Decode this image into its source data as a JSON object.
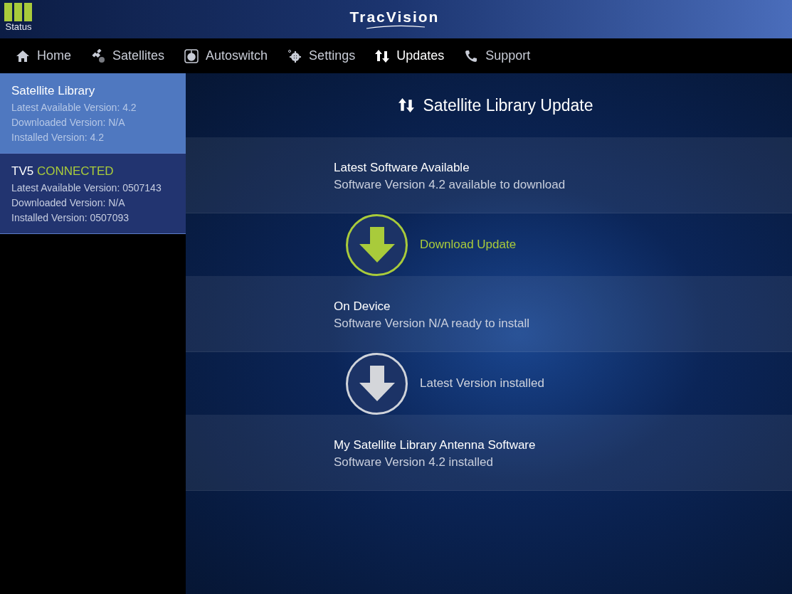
{
  "header": {
    "status_label": "Status",
    "logo": "TracVision"
  },
  "nav": [
    {
      "kind": "home",
      "label": "Home",
      "selected": false
    },
    {
      "kind": "satellite",
      "label": "Satellites",
      "selected": false
    },
    {
      "kind": "autoswitch",
      "label": "Autoswitch",
      "selected": false
    },
    {
      "kind": "settings",
      "label": "Settings",
      "selected": false
    },
    {
      "kind": "updates",
      "label": "Updates",
      "selected": true
    },
    {
      "kind": "support",
      "label": "Support",
      "selected": false
    }
  ],
  "sidebar": {
    "items": [
      {
        "name": "Satellite Library",
        "lines": [
          "Latest Available Version: 4.2",
          "Downloaded Version: N/A",
          "Installed Version: 4.2"
        ],
        "selected": true
      },
      {
        "name": "TV5",
        "status": "CONNECTED",
        "lines": [
          "Latest Available Version: 0507143",
          "Downloaded Version: N/A",
          "Installed Version: 0507093"
        ],
        "selected": false
      }
    ]
  },
  "main": {
    "title": "Satellite Library Update",
    "sections": [
      {
        "heading": "Latest Software Available",
        "detail": "Software Version 4.2 available to download",
        "action": {
          "label": "Download Update",
          "enabled": true
        }
      },
      {
        "heading": "On Device",
        "detail": "Software Version N/A ready to install",
        "action": {
          "label": "Latest Version installed",
          "enabled": false
        }
      },
      {
        "heading": "My Satellite Library Antenna Software",
        "detail": "Software Version 4.2 installed"
      }
    ]
  }
}
